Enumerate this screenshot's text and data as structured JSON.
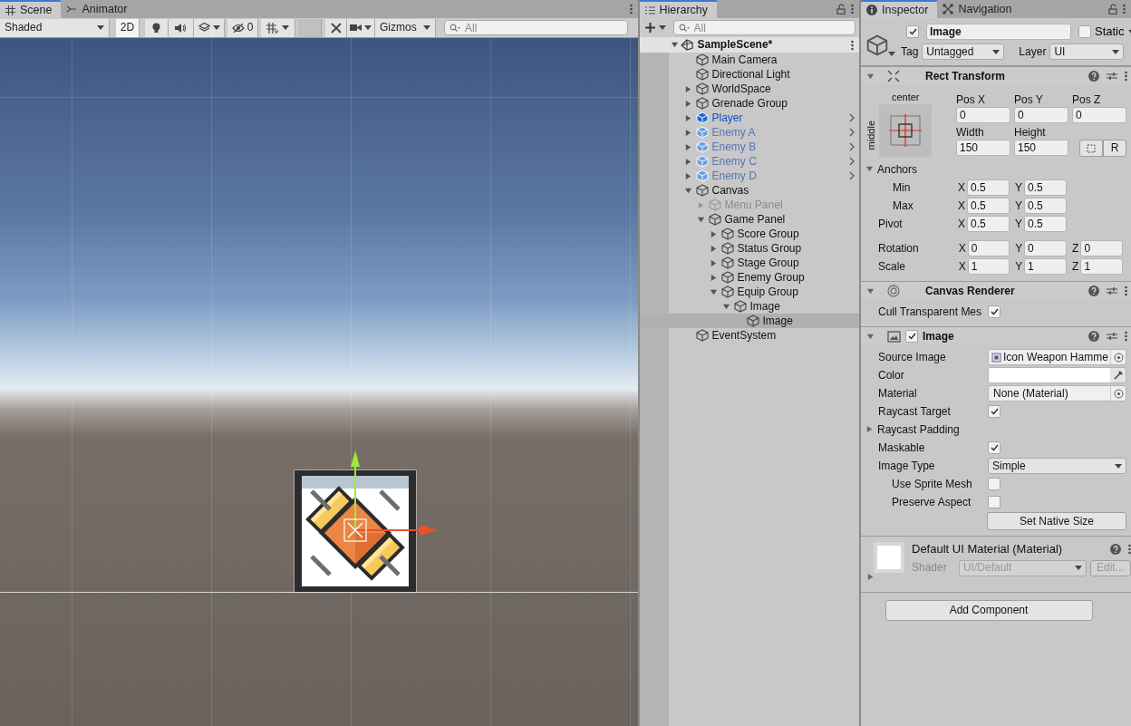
{
  "scene_view": {
    "tabs": [
      {
        "label": "Scene",
        "selected": true
      },
      {
        "label": "Animator",
        "selected": false
      }
    ],
    "toolbar": {
      "shading": "Shaded",
      "mode_2d": {
        "label": "2D",
        "on": true
      },
      "hidden_count": "0",
      "gizmos": "Gizmos",
      "search_placeholder": "All"
    }
  },
  "hierarchy": {
    "tab": "Hierarchy",
    "search_placeholder": "All",
    "scene": {
      "name": "SampleScene*",
      "expanded": true
    },
    "items": [
      {
        "name": "Main Camera",
        "kind": "object",
        "active": true,
        "selected": false
      },
      {
        "name": "Directional Light",
        "kind": "object",
        "active": true,
        "selected": false
      },
      {
        "name": "WorldSpace",
        "kind": "object",
        "active": true,
        "selected": false,
        "expanded": false
      },
      {
        "name": "Grenade Group",
        "kind": "object",
        "active": true,
        "selected": false,
        "expanded": false
      },
      {
        "name": "Player",
        "kind": "prefab",
        "active": true,
        "selected": false,
        "expanded": false
      },
      {
        "name": "Enemy A",
        "kind": "prefab_variant",
        "active": true,
        "selected": false,
        "expanded": false
      },
      {
        "name": "Enemy B",
        "kind": "prefab_variant",
        "active": true,
        "selected": false,
        "expanded": false
      },
      {
        "name": "Enemy C",
        "kind": "prefab_variant",
        "active": true,
        "selected": false,
        "expanded": false
      },
      {
        "name": "Enemy D",
        "kind": "prefab_variant",
        "active": true,
        "selected": false,
        "expanded": false
      },
      {
        "name": "Canvas",
        "kind": "object",
        "active": true,
        "selected": false,
        "expanded": true,
        "children": [
          {
            "name": "Menu Panel",
            "kind": "object",
            "active": false,
            "selected": false,
            "expanded": false
          },
          {
            "name": "Game Panel",
            "kind": "object",
            "active": true,
            "selected": false,
            "expanded": true,
            "children": [
              {
                "name": "Score Group",
                "kind": "object",
                "active": true,
                "selected": false,
                "expanded": false
              },
              {
                "name": "Status Group",
                "kind": "object",
                "active": true,
                "selected": false,
                "expanded": false
              },
              {
                "name": "Stage Group",
                "kind": "object",
                "active": true,
                "selected": false,
                "expanded": false
              },
              {
                "name": "Enemy Group",
                "kind": "object",
                "active": true,
                "selected": false,
                "expanded": false
              },
              {
                "name": "Equip Group",
                "kind": "object",
                "active": true,
                "selected": false,
                "expanded": true,
                "children": [
                  {
                    "name": "Image",
                    "kind": "object",
                    "active": true,
                    "selected": false,
                    "expanded": true,
                    "children": [
                      {
                        "name": "Image",
                        "kind": "object",
                        "active": true,
                        "selected": true
                      }
                    ]
                  }
                ]
              }
            ]
          }
        ]
      },
      {
        "name": "EventSystem",
        "kind": "object",
        "active": true,
        "selected": false
      }
    ]
  },
  "inspector": {
    "tabs": [
      {
        "label": "Inspector",
        "selected": true
      },
      {
        "label": "Navigation",
        "selected": false
      }
    ],
    "object": {
      "active": true,
      "name": "Image",
      "static": false,
      "static_label": "Static",
      "tag_label": "Tag",
      "tag": "Untagged",
      "layer_label": "Layer",
      "layer": "UI"
    },
    "components": [
      {
        "kind": "rect_transform",
        "title": "Rect Transform",
        "expanded": true,
        "anchor_h": "center",
        "anchor_v": "middle",
        "pos_labels": [
          "Pos X",
          "Pos Y",
          "Pos Z"
        ],
        "pos_values": [
          "0",
          "0",
          "0"
        ],
        "size_labels": [
          "Width",
          "Height"
        ],
        "size_values": [
          "150",
          "150"
        ],
        "raw_button": "R",
        "anchors": {
          "label": "Anchors",
          "expanded": true,
          "rows": [
            {
              "label": "Min",
              "axes": [
                {
                  "axis": "X",
                  "value": "0.5"
                },
                {
                  "axis": "Y",
                  "value": "0.5"
                }
              ]
            },
            {
              "label": "Max",
              "axes": [
                {
                  "axis": "X",
                  "value": "0.5"
                },
                {
                  "axis": "Y",
                  "value": "0.5"
                }
              ]
            }
          ]
        },
        "vectors": [
          {
            "label": "Pivot",
            "axes": [
              {
                "axis": "X",
                "value": "0.5"
              },
              {
                "axis": "Y",
                "value": "0.5"
              }
            ]
          },
          {
            "label": "Rotation",
            "axes": [
              {
                "axis": "X",
                "value": "0"
              },
              {
                "axis": "Y",
                "value": "0"
              },
              {
                "axis": "Z",
                "value": "0"
              }
            ]
          },
          {
            "label": "Scale",
            "axes": [
              {
                "axis": "X",
                "value": "1"
              },
              {
                "axis": "Y",
                "value": "1"
              },
              {
                "axis": "Z",
                "value": "1"
              }
            ]
          }
        ]
      },
      {
        "kind": "canvas_renderer",
        "title": "Canvas Renderer",
        "expanded": true,
        "properties": [
          {
            "kind": "checkbox",
            "label": "Cull Transparent Mes",
            "checked": true
          }
        ]
      },
      {
        "kind": "image",
        "title": "Image",
        "expanded": true,
        "enabled": true,
        "properties": [
          {
            "kind": "sprite_object",
            "label": "Source Image",
            "value": "Icon Weapon Hamme"
          },
          {
            "kind": "color",
            "label": "Color"
          },
          {
            "kind": "object",
            "label": "Material",
            "value": "None (Material)"
          },
          {
            "kind": "checkbox",
            "label": "Raycast Target",
            "checked": true
          },
          {
            "kind": "foldout",
            "label": "Raycast Padding",
            "expanded": false
          },
          {
            "kind": "checkbox",
            "label": "Maskable",
            "checked": true
          },
          {
            "kind": "dropdown",
            "label": "Image Type",
            "value": "Simple"
          },
          {
            "kind": "checkbox",
            "label": "Use Sprite Mesh",
            "checked": false,
            "indented": true
          },
          {
            "kind": "checkbox",
            "label": "Preserve Aspect",
            "checked": false,
            "indented": true
          },
          {
            "kind": "button",
            "label": "Set Native Size"
          }
        ]
      },
      {
        "kind": "material",
        "title": "Default UI Material (Material)",
        "expanded": false,
        "shader_label": "Shader",
        "shader": "UI/Default",
        "edit_button": "Edit..."
      }
    ],
    "add_component": "Add Component"
  }
}
